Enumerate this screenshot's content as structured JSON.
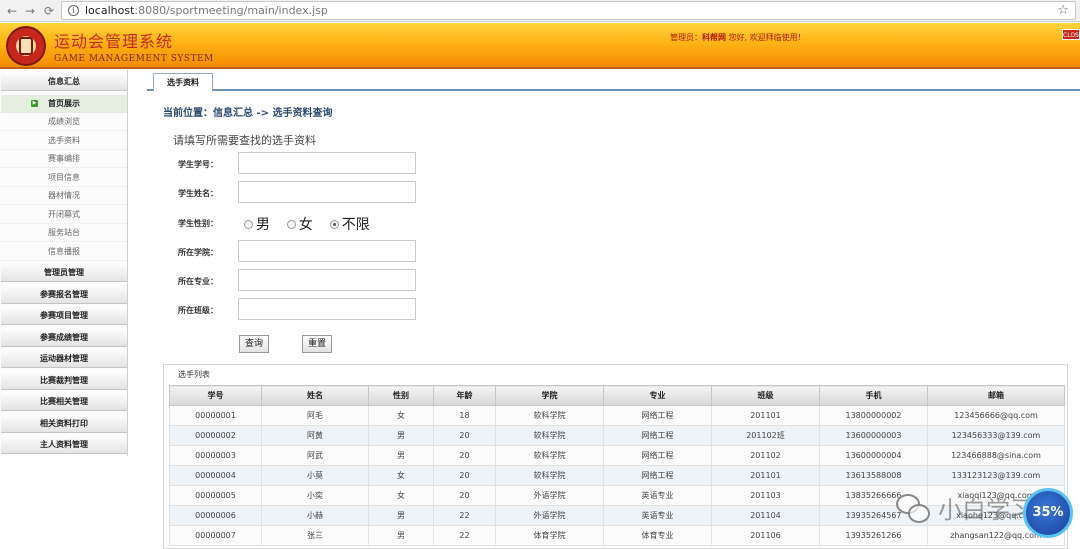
{
  "browser": {
    "back_glyph": "←",
    "forward_glyph": "→",
    "reload_glyph": "⟳",
    "url_host": "localhost",
    "url_rest": ":8080/sportmeeting/main/index.jsp",
    "star_glyph": "☆"
  },
  "header": {
    "title": "运动会管理系统",
    "subtitle": "GAME MANAGEMENT SYSTEM",
    "greeting_prefix": "管理员：",
    "username": "科帮网",
    "greeting_suffix": " 您好, 欢迎拜临使用！",
    "close_label": "CLOSE",
    "colors": {
      "header_top": "#ffd33b",
      "header_bottom": "#f28b00",
      "title": "#c8281c"
    }
  },
  "sidebar": {
    "sections": [
      {
        "label": "信息汇总"
      },
      {
        "label": "管理员管理"
      },
      {
        "label": "参赛报名管理"
      },
      {
        "label": "参赛项目管理"
      },
      {
        "label": "参赛成绩管理"
      },
      {
        "label": "运动器材管理"
      },
      {
        "label": "比赛裁判管理"
      },
      {
        "label": "比赛相关管理"
      },
      {
        "label": "相关资料打印"
      },
      {
        "label": "主人资料管理"
      }
    ],
    "items": [
      {
        "label": "首页展示",
        "active": true
      },
      {
        "label": "成绩浏览"
      },
      {
        "label": "选手资料"
      },
      {
        "label": "赛事编排"
      },
      {
        "label": "项目信息"
      },
      {
        "label": "器材情况"
      },
      {
        "label": "开闭幕式"
      },
      {
        "label": "服务站台"
      },
      {
        "label": "信息播报"
      }
    ]
  },
  "main": {
    "tab": "选手资料",
    "breadcrumb": "当前位置：信息汇总 -> 选手资料查询",
    "form_heading": "请填写所需要查找的选手资料",
    "fields": {
      "student_id": {
        "label": "学生学号：",
        "value": ""
      },
      "student_name": {
        "label": "学生姓名：",
        "value": ""
      },
      "gender": {
        "label": "学生性别：",
        "options": [
          "男",
          "女",
          "不限"
        ],
        "selected": "不限"
      },
      "college": {
        "label": "所在学院：",
        "value": ""
      },
      "major": {
        "label": "所在专业：",
        "value": ""
      },
      "class": {
        "label": "所在班级：",
        "value": ""
      }
    },
    "buttons": {
      "query": "查询",
      "reset": "重置"
    }
  },
  "results": {
    "title": "选手列表",
    "columns": [
      "学号",
      "姓名",
      "性别",
      "年龄",
      "学院",
      "专业",
      "班级",
      "手机",
      "邮箱"
    ],
    "rows": [
      [
        "00000001",
        "阿毛",
        "女",
        "18",
        "软科学院",
        "网络工程",
        "201101",
        "13800000002",
        "123456666@qq.com"
      ],
      [
        "00000002",
        "阿黄",
        "男",
        "20",
        "软科学院",
        "网络工程",
        "201102班",
        "13600000003",
        "123456333@139.com"
      ],
      [
        "00000003",
        "阿武",
        "男",
        "20",
        "软科学院",
        "网络工程",
        "201102",
        "13600000004",
        "123466888@sina.com"
      ],
      [
        "00000004",
        "小莫",
        "女",
        "20",
        "软科学院",
        "网络工程",
        "201101",
        "13613588008",
        "133123123@139.com"
      ],
      [
        "00000005",
        "小奕",
        "女",
        "20",
        "外语学院",
        "英语专业",
        "201103",
        "13835266666",
        "xiaoqi123@qq.com"
      ],
      [
        "00000006",
        "小赫",
        "男",
        "22",
        "外语学院",
        "英语专业",
        "201104",
        "13935264567",
        "xiaohe123@qq.com"
      ],
      [
        "00000007",
        "张三",
        "男",
        "22",
        "体育学院",
        "体育专业",
        "201106",
        "13935261266",
        "zhangsan122@qq.com"
      ]
    ]
  },
  "watermark": {
    "text": "小白学习",
    "badge": "35%"
  }
}
